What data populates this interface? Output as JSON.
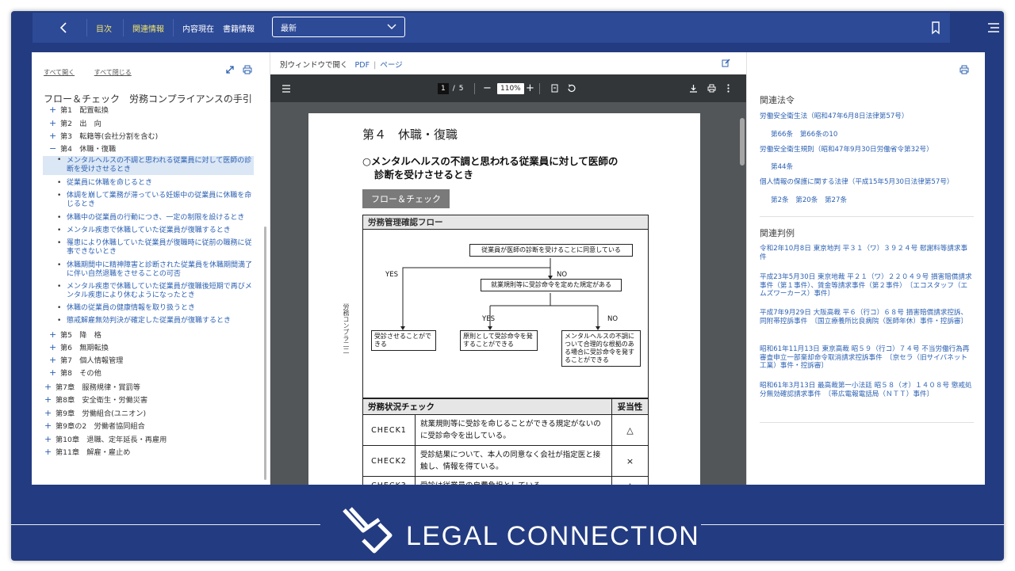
{
  "topbar": {
    "tabs": [
      "目次",
      "関連情報",
      "内容現在",
      "書籍情報"
    ],
    "select_value": "最新"
  },
  "left": {
    "expand_all": "すべて開く",
    "collapse_all": "すべて閉じる",
    "book_title": "フロー＆チェック　労務コンプライアンスの手引",
    "sections": [
      {
        "sign": "+",
        "label": "第1　配置転換"
      },
      {
        "sign": "+",
        "label": "第2　出　向"
      },
      {
        "sign": "+",
        "label": "第3　転籍等(会社分割を含む)"
      },
      {
        "sign": "−",
        "label": "第4　休職・復職"
      }
    ],
    "subitems": [
      "メンタルヘルスの不調と思われる従業員に対して医師の診断を受けさせるとき",
      "従業員に休職を命じるとき",
      "体調を崩して業務が滞っている妊娠中の従業員に休職を命じるとき",
      "休職中の従業員の行動につき、一定の制限を設けるとき",
      "メンタル疾患で休職していた従業員が復職するとき",
      "罹患により休職していた従業員が復職時に従前の職務に従事できないとき",
      "休職期間中に精神障害と診断された従業員を休職期間満了に伴い自然退職をさせることの可否",
      "メンタル疾患で休職していた従業員が復職後短期で再びメンタル疾患により休むようになったとき",
      "休職の従業員の健康情報を取り扱うとき",
      "懲戒解雇無効判決が確定した従業員が復職するとき"
    ],
    "sections_after": [
      {
        "sign": "+",
        "label": "第5　降　格"
      },
      {
        "sign": "+",
        "label": "第6　無期転換"
      },
      {
        "sign": "+",
        "label": "第7　個人情報管理"
      },
      {
        "sign": "+",
        "label": "第8　その他"
      }
    ],
    "chapters": [
      {
        "sign": "+",
        "label": "第7章　服務規律・賞罰等"
      },
      {
        "sign": "+",
        "label": "第8章　安全衛生・労働災害"
      },
      {
        "sign": "+",
        "label": "第9章　労働組合(ユニオン)"
      },
      {
        "sign": "+",
        "label": "第9章の2　労働者協同組合"
      },
      {
        "sign": "+",
        "label": "第10章　退職、定年延長・再雇用"
      },
      {
        "sign": "+",
        "label": "第11章　解雇・雇止め"
      }
    ]
  },
  "viewer": {
    "open_window": "別ウィンドウで開く",
    "pdf_link": "PDF",
    "page_link": "ページ",
    "page_current": "1",
    "page_total": "5",
    "zoom": "110%",
    "page": {
      "chapter": "第４　休職・復職",
      "heading_line1": "○メンタルヘルスの不調と思われる従業員に対して医師の",
      "heading_line2": "診断を受けさせるとき",
      "badge": "フロー＆チェック",
      "side_text": "労務コンプラ二二",
      "flow_title": "労務管理確認フロー",
      "flow": {
        "top": "従業員が医師の診断を受けることに同意している",
        "yes1": "YES",
        "no1": "NO",
        "middle": "就業規則等に受診命令を定めた規定がある",
        "yes2": "YES",
        "no2": "NO",
        "leaf1": "受診させることができる",
        "leaf2": "原則として受診命令を発することができる",
        "leaf3": "メンタルヘルスの不調について合理的な根拠のある場合に受診命令を発することができる"
      },
      "check_title": "労務状況チェック",
      "check_eval": "妥当性",
      "checks": [
        {
          "id": "CHECK1",
          "desc": "就業規則等に受診を命じることができる規定がないのに受診命令を出している。",
          "result": "△"
        },
        {
          "id": "CHECK2",
          "desc": "受診結果について、本人の同意なく会社が指定医と接触し、情報を得ている。",
          "result": "×"
        },
        {
          "id": "CHECK3",
          "desc": "受診は従業員の自費負担としている。",
          "result": "△"
        }
      ]
    }
  },
  "right": {
    "laws_title": "関連法令",
    "laws": [
      {
        "name": "労働安全衛生法（昭和47年6月8日法律第57号）",
        "articles": "第66条　第66条の10"
      },
      {
        "name": "労働安全衛生規則（昭和47年9月30日労働省令第32号）",
        "articles": "第44条"
      },
      {
        "name": "個人情報の保護に関する法律（平成15年5月30日法律第57号）",
        "articles": "第2条　第20条　第27条"
      }
    ],
    "cases_title": "関連判例",
    "cases": [
      "令和2年10月8日 東京地判 平３１（ワ）３９２４号 慰謝料等請求事件",
      "平成23年5月30日 東京地裁 平２１（ワ）２２０４９号 損害賠償請求事件（第１事件）、賃金等請求事件（第２事件）　〔エコスタッフ（エムズワーカース）事件〕",
      "平成7年9月29日 大阪高裁 平６（行コ）６８号 損害賠償請求控訴、同附帯控訴事件　〔国立療養所比良病院（医師年休）事件・控訴審〕",
      "昭和61年11月13日 東京高裁 昭５９（行コ）７４号 不当労働行為再審査申立一部棄却命令取消請求控訴事件　〔京セラ（旧サイバネット工業）事件・控訴審〕",
      "昭和61年3月13日 最高裁第一小法廷 昭５８（オ）１４０８号 懲戒処分無効確認請求事件　〔帯広電報電話局（ＮＴＴ）事件〕"
    ]
  },
  "brand": {
    "name": "LEGAL CONNECTION"
  }
}
